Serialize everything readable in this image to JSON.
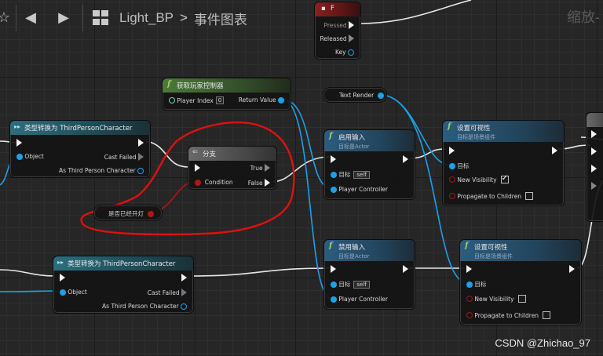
{
  "toolbar": {
    "star_icon": "star-icon",
    "back_icon": "arrow-left-icon",
    "forward_icon": "arrow-right-icon",
    "blueprint_name": "Light_BP",
    "separator": ">",
    "graph_name": "事件图表",
    "zoom_label": "缩放-"
  },
  "nodes": {
    "key_f": {
      "title": "F",
      "pressed": "Pressed",
      "released": "Released",
      "key": "Key"
    },
    "get_player_controller": {
      "title": "获取玩家控制器",
      "player_index_label": "Player Index",
      "player_index_value": "0",
      "return_value": "Return Value"
    },
    "text_render": {
      "label": "Text Render"
    },
    "cast1": {
      "title": "类型转换为 ThirdPersonCharacter",
      "object": "Object",
      "cast_failed": "Cast Failed",
      "as_char": "As Third Person Character"
    },
    "branch": {
      "title": "分支",
      "true_label": "True",
      "condition": "Condition",
      "false_label": "False"
    },
    "is_light_on": {
      "label": "是否已经开灯"
    },
    "enable_input": {
      "title": "启用输入",
      "subtitle": "目标是Actor",
      "target": "目标",
      "self": "self",
      "player_controller": "Player Controller"
    },
    "set_visibility1": {
      "title": "设置可视性",
      "subtitle": "目标是场景组件",
      "target": "目标",
      "new_visibility": "New Visibility",
      "new_visibility_checked": true,
      "propagate": "Propagate to Children",
      "propagate_checked": false
    },
    "cast2": {
      "title": "类型转换为 ThirdPersonCharacter",
      "object": "Object",
      "cast_failed": "Cast Failed",
      "as_char": "As Third Person Character"
    },
    "disable_input": {
      "title": "禁用输入",
      "subtitle": "目标是Actor",
      "target": "目标",
      "self": "self",
      "player_controller": "Player Controller"
    },
    "set_visibility2": {
      "title": "设置可视性",
      "subtitle": "目标是场景组件",
      "target": "目标",
      "new_visibility": "New Visibility",
      "new_visibility_checked": false,
      "propagate": "Propagate to Children",
      "propagate_checked": false
    }
  },
  "watermark": "CSDN @Zhichao_97",
  "colors": {
    "exec": "#f2f2f2",
    "object_pin": "#1ba1ea",
    "bool_pin": "#b31616",
    "annotation": "#e01010"
  }
}
